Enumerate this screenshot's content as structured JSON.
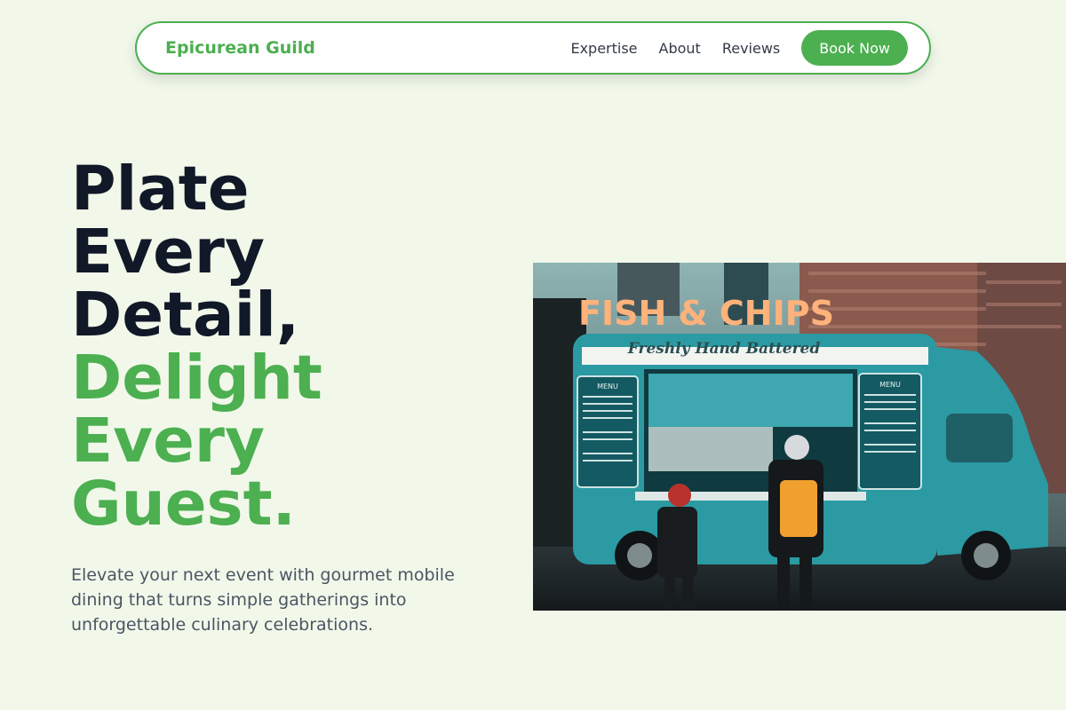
{
  "nav": {
    "brand": "Epicurean Guild",
    "links": [
      "Expertise",
      "About",
      "Reviews"
    ],
    "cta": "Book Now"
  },
  "hero": {
    "headline_dark": [
      "Plate",
      "Every",
      "Detail,"
    ],
    "headline_green": [
      "Delight",
      "Every",
      "Guest."
    ],
    "subtitle": "Elevate your next event with gourmet mobile dining that turns simple gatherings into unforgettable culinary celebrations.",
    "image": {
      "sign": "FISH & CHIPS",
      "banner": "Freshly Hand Battered",
      "menu_title": "MENU"
    }
  },
  "colors": {
    "background": "#f1f8ea",
    "accent": "#4caf50",
    "heading": "#111827",
    "body_text": "#4b5563",
    "truck": "#2b9aa3"
  }
}
